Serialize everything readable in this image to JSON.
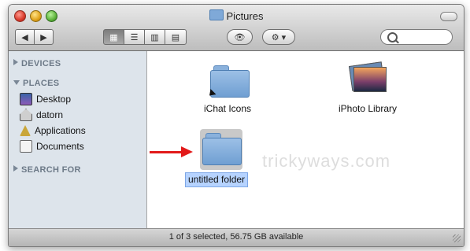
{
  "window": {
    "title": "Pictures",
    "title_icon": "folder-icon"
  },
  "toolbar": {
    "back_icon": "◀",
    "forward_icon": "▶",
    "view_icons_glyph": "▦",
    "view_list_glyph": "☰",
    "view_columns_glyph": "▥",
    "view_coverflow_glyph": "▤",
    "quicklook_glyph": "👁",
    "action_glyph": "⚙ ▾",
    "search_placeholder": ""
  },
  "sidebar": {
    "sections": [
      {
        "label": "DEVICES",
        "expanded": false
      },
      {
        "label": "PLACES",
        "expanded": true
      },
      {
        "label": "SEARCH FOR",
        "expanded": false
      }
    ],
    "places": [
      {
        "label": "Desktop",
        "icon": "desktop-icon"
      },
      {
        "label": "datorn",
        "icon": "home-icon"
      },
      {
        "label": "Applications",
        "icon": "applications-icon"
      },
      {
        "label": "Documents",
        "icon": "documents-icon"
      }
    ]
  },
  "content": {
    "items": [
      {
        "label": "iChat Icons",
        "icon": "folder-alias-icon",
        "selected": false
      },
      {
        "label": "iPhoto Library",
        "icon": "iphoto-library-icon",
        "selected": false
      },
      {
        "label": "untitled folder",
        "icon": "folder-icon",
        "selected": true
      }
    ],
    "watermark": "trickyways.com"
  },
  "status": {
    "text": "1 of 3 selected, 56.75 GB available"
  },
  "colors": {
    "sidebar_bg": "#dde4eb",
    "selection": "#b6d3ff",
    "arrow": "#e21a1a"
  }
}
